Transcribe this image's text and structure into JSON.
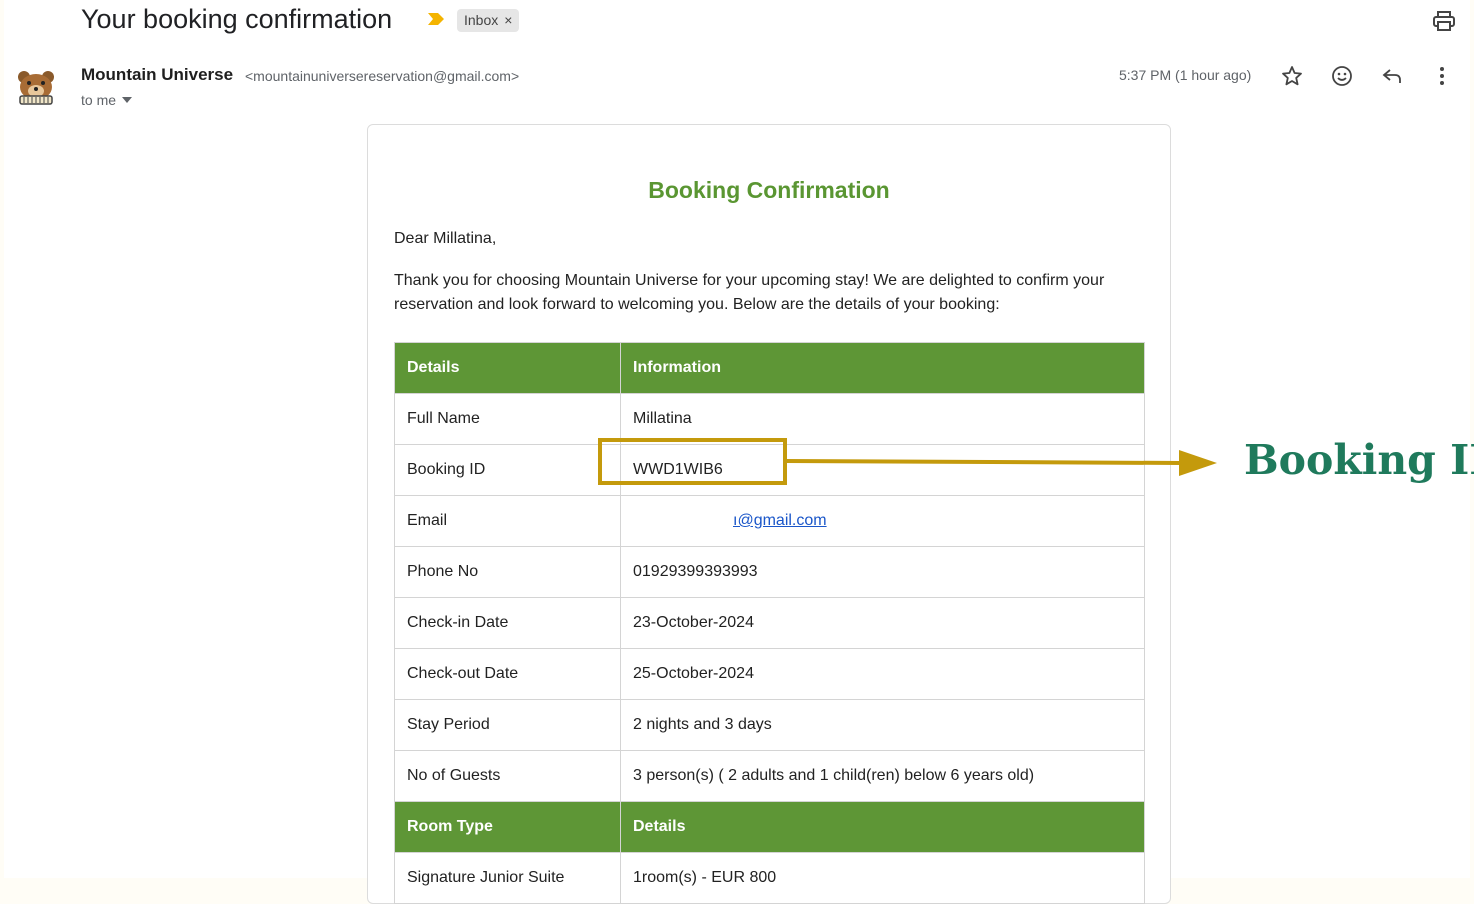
{
  "email": {
    "subject": "Your booking confirmation",
    "label": "Inbox",
    "label_close": "×",
    "sender_name": "Mountain Universe",
    "sender_email": "<mountainuniversereservation@gmail.com>",
    "recipient": "to me",
    "timestamp": "5:37 PM (1 hour ago)"
  },
  "body": {
    "title": "Booking Confirmation",
    "greeting": "Dear Millatina,",
    "intro": "Thank you for choosing Mountain Universe for your upcoming stay! We are delighted to confirm your reservation and look forward to welcoming you. Below are the details of your booking:",
    "table_header": {
      "col1": "Details",
      "col2": "Information"
    },
    "rows": [
      {
        "label": "Full Name",
        "value": "Millatina"
      },
      {
        "label": "Booking ID",
        "value": "WWD1WIB6"
      },
      {
        "label": "Email",
        "value": "ı@gmail.com"
      },
      {
        "label": "Phone No",
        "value": "01929399393993"
      },
      {
        "label": "Check-in Date",
        "value": "23-October-2024"
      },
      {
        "label": "Check-out Date",
        "value": "25-October-2024"
      },
      {
        "label": "Stay Period",
        "value": "2 nights and 3 days"
      },
      {
        "label": "No of Guests",
        "value": "3 person(s) ( 2 adults and 1 child(ren) below 6 years old)"
      }
    ],
    "room_header": {
      "col1": "Room Type",
      "col2": "Details"
    },
    "room_rows": [
      {
        "label": "Signature Junior Suite",
        "value": "1room(s) - EUR 800"
      }
    ]
  },
  "annotation": {
    "label": "Booking ID",
    "color": "#c49a0c",
    "label_color": "#1f7a5c"
  },
  "colors": {
    "table_header": "#5e9636",
    "title": "#5a9632"
  },
  "icons": [
    "important-marker-icon",
    "print-icon",
    "bear-avatar-icon",
    "dropdown-caret-icon",
    "star-icon",
    "emoji-icon",
    "reply-icon",
    "more-vert-icon"
  ]
}
